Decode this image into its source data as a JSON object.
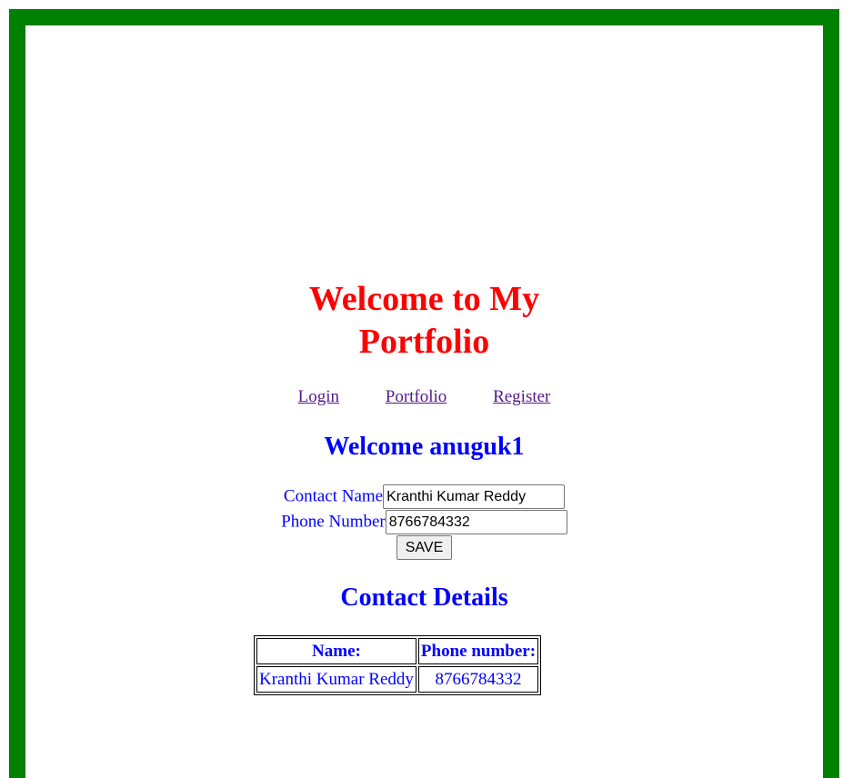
{
  "title": "Welcome to My Portfolio",
  "title_lines": [
    "Welcome to My",
    "Portfolio"
  ],
  "nav": {
    "login": "Login",
    "portfolio": "Portfolio",
    "register": "Register"
  },
  "welcome": "Welcome anuguk1",
  "form": {
    "contact_name_label": "Contact Name",
    "contact_name_value": "Kranthi Kumar Reddy",
    "phone_label": "Phone Number",
    "phone_value": "8766784332",
    "save_label": "SAVE"
  },
  "details_heading": "Contact Details",
  "table": {
    "headers": [
      "Name:",
      "Phone number:"
    ],
    "rows": [
      [
        "Kranthi Kumar Reddy",
        "8766784332"
      ]
    ]
  },
  "colors": {
    "border": "#008000",
    "title": "#ff0000",
    "text": "#0000ff"
  }
}
